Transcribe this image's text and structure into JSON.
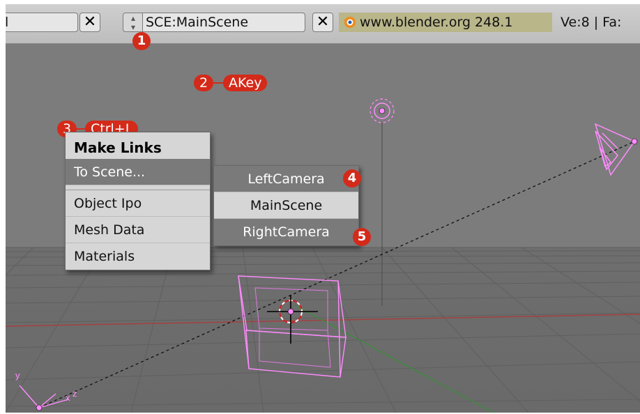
{
  "header": {
    "left_field": "l",
    "close_label": "✕",
    "scene_field": "SCE:MainScene",
    "url_text": "www.blender.org 248.1",
    "stats_text": "Ve:8 | Fa:"
  },
  "annotations": {
    "n1": "1",
    "n2": "2",
    "akey": "AKey",
    "n3": "3",
    "ctrl_l": "Ctrl+L",
    "n4": "4",
    "n5": "5"
  },
  "make_links_menu": {
    "title": "Make Links",
    "items": [
      "To Scene...",
      "Object Ipo",
      "Mesh Data",
      "Materials"
    ]
  },
  "scene_submenu": {
    "items": [
      "LeftCamera",
      "MainScene",
      "RightCamera"
    ]
  },
  "axes": {
    "x": "x",
    "y": "y",
    "z": "z"
  },
  "colors": {
    "viewport_bg": "#7c7c7c",
    "selection_pink": "#ff8cff",
    "annotation_red": "#d42a1a",
    "url_bg": "#b9b68a"
  }
}
